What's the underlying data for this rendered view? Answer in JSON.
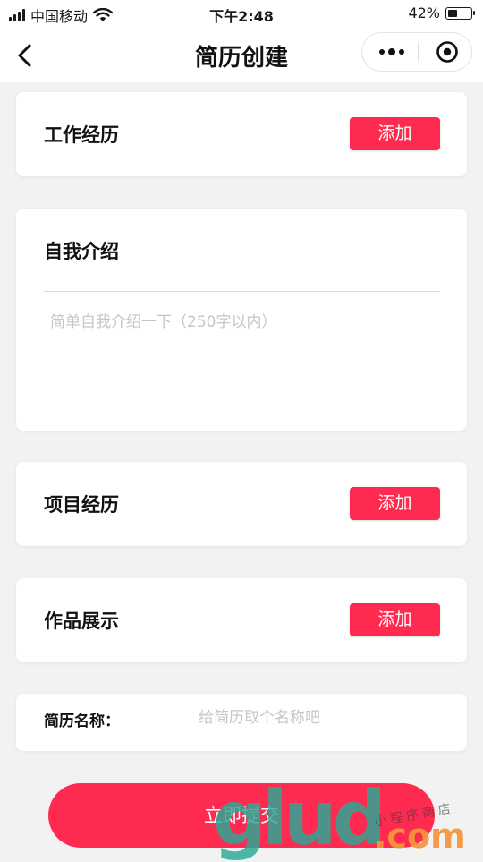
{
  "status_bar": {
    "carrier": "中国移动",
    "time": "下午2:48",
    "battery_percent": "42%",
    "battery_level": 0.42,
    "icons": [
      "signal-bars-icon",
      "wifi-icon",
      "battery-icon"
    ]
  },
  "nav": {
    "title": "简历创建",
    "icons": [
      "back-arrow-icon",
      "more-dots-icon",
      "close-target-icon"
    ]
  },
  "sections": {
    "work": {
      "title": "工作经历",
      "add_label": "添加"
    },
    "intro": {
      "title": "自我介绍",
      "placeholder": "简单自我介绍一下（250字以内）",
      "value": ""
    },
    "project": {
      "title": "项目经历",
      "add_label": "添加"
    },
    "portfolio": {
      "title": "作品展示",
      "add_label": "添加"
    },
    "resume_name": {
      "label": "简历名称：",
      "placeholder": "给简历取个名称吧",
      "value": ""
    }
  },
  "submit": {
    "label": "立即提交"
  },
  "watermark": {
    "brand": "glud",
    "domain": ".com",
    "tagline": "小程序商店"
  },
  "colors": {
    "accent": "#ff2a4f",
    "background": "#f2f2f2",
    "card": "#ffffff",
    "watermark_teal": "#28aa96",
    "watermark_orange": "#f2963c"
  }
}
